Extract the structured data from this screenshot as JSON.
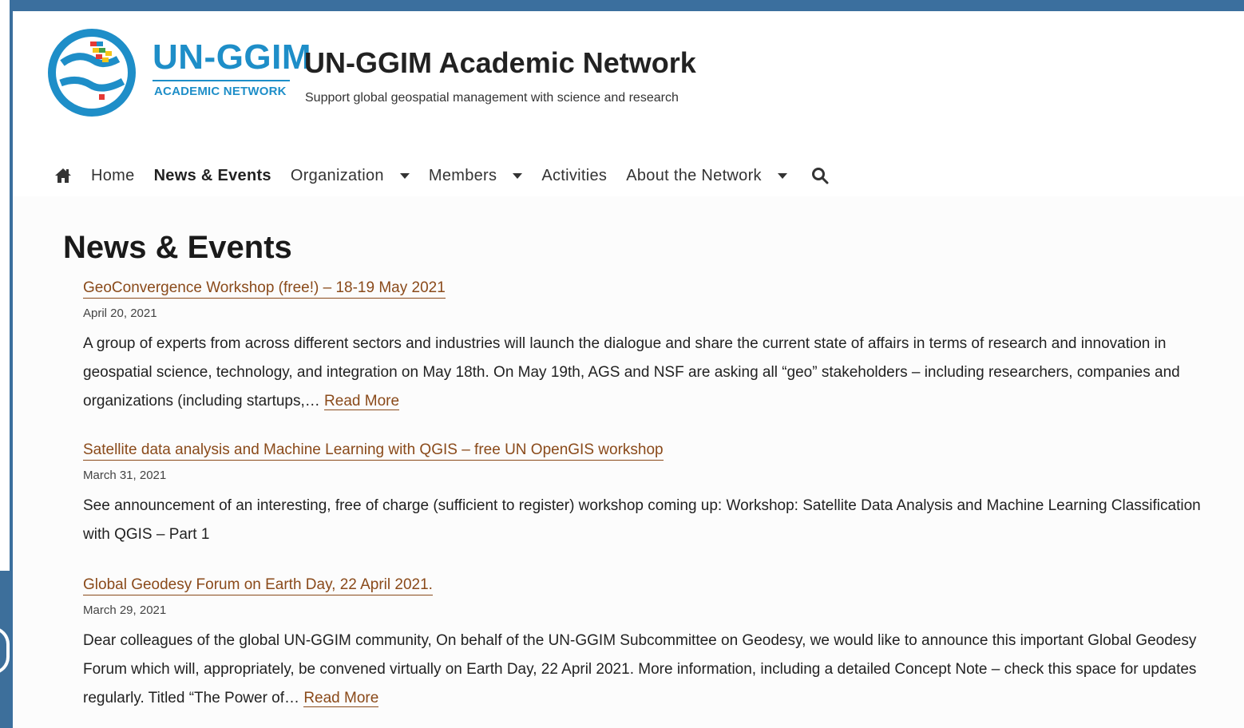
{
  "header": {
    "logo_word": "UN-GGIM",
    "logo_sub": "ACADEMIC NETWORK",
    "site_title": "UN-GGIM Academic Network",
    "site_tagline": "Support global geospatial management with science and research"
  },
  "nav": {
    "items": [
      {
        "label": "Home"
      },
      {
        "label": "News & Events"
      },
      {
        "label": "Organization"
      },
      {
        "label": "Members"
      },
      {
        "label": "Activities"
      },
      {
        "label": "About the Network"
      }
    ]
  },
  "main": {
    "page_title": "News & Events",
    "read_more": "Read More",
    "posts": [
      {
        "title": "GeoConvergence Workshop (free!) – 18-19 May 2021",
        "date": "April 20, 2021",
        "excerpt": "A group of experts from across different sectors and industries will launch the dialogue and share the current state of affairs in terms of research and innovation in geospatial science, technology, and integration on May 18th. On May 19th, AGS and NSF are asking all “geo” stakeholders – including researchers, companies and organizations (including startups,…"
      },
      {
        "title": "Satellite data analysis and Machine Learning with QGIS – free UN OpenGIS workshop",
        "date": "March 31, 2021",
        "excerpt": "See announcement of an interesting, free of charge (sufficient to register) workshop coming up: Workshop: Satellite Data Analysis and Machine Learning Classification with QGIS – Part 1"
      },
      {
        "title": "Global Geodesy Forum on Earth Day, 22 April 2021.",
        "date": "March 29, 2021",
        "excerpt": "Dear colleagues of the global UN-GGIM community, On behalf of the UN-GGIM Subcommittee on Geodesy, we would like to announce this important Global Geodesy Forum which will, appropriately, be convened virtually on Earth Day, 22 April 2021. More information, including a detailed Concept Note – check this space for updates regularly. Titled “The Power of…"
      }
    ]
  },
  "colors": {
    "brand_blue": "#1e8ec8",
    "link_brown": "#8a4a1a",
    "frame_blue": "#3b6f9e"
  }
}
